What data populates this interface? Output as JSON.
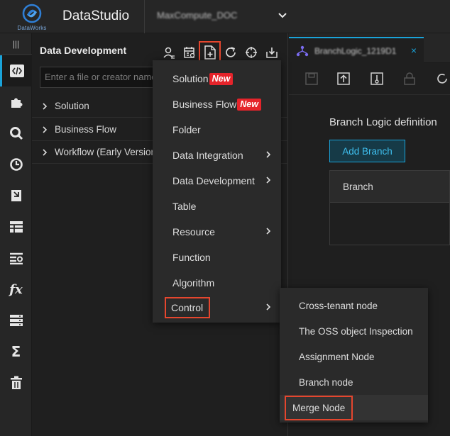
{
  "app": {
    "logo_text": "DataWorks",
    "title": "DataStudio",
    "project": "MaxCompute_DOC"
  },
  "rail": {
    "items": [
      {
        "icon": "code-icon",
        "active": true
      },
      {
        "icon": "puzzle-icon"
      },
      {
        "icon": "search-icon"
      },
      {
        "icon": "clock-icon"
      },
      {
        "icon": "bookmark-icon"
      },
      {
        "icon": "table-icon"
      },
      {
        "icon": "list-settings-icon"
      },
      {
        "icon": "function-icon",
        "glyph": "fx"
      },
      {
        "icon": "stack-icon"
      },
      {
        "icon": "sigma-icon",
        "glyph": "Σ"
      },
      {
        "icon": "trash-icon"
      }
    ]
  },
  "panel": {
    "title": "Data Development",
    "search_placeholder": "Enter a file or creator name",
    "tree": [
      {
        "label": "Solution"
      },
      {
        "label": "Business Flow"
      },
      {
        "label": "Workflow (Early Version"
      }
    ]
  },
  "tab": {
    "name": "BranchLogic_1219D1",
    "close": "×"
  },
  "editor": {
    "branch_title": "Branch Logic definition",
    "add_branch_label": "Add Branch",
    "table_header": "Branch"
  },
  "menu": {
    "items": [
      {
        "label": "Solution",
        "badge": "New"
      },
      {
        "label": "Business Flow",
        "badge": "New"
      },
      {
        "label": "Folder"
      },
      {
        "label": "Data Integration",
        "submenu": true
      },
      {
        "label": "Data Development",
        "submenu": true
      },
      {
        "label": "Table"
      },
      {
        "label": "Resource",
        "submenu": true
      },
      {
        "label": "Function"
      },
      {
        "label": "Algorithm"
      },
      {
        "label": "Control",
        "submenu": true,
        "highlighted": true
      }
    ]
  },
  "submenu": {
    "items": [
      {
        "label": "Cross-tenant node"
      },
      {
        "label": "The OSS object Inspection"
      },
      {
        "label": "Assignment Node"
      },
      {
        "label": "Branch node"
      },
      {
        "label": "Merge Node",
        "highlighted": true
      }
    ]
  },
  "colors": {
    "accent": "#1aa3d9",
    "highlight_box": "#e5462e",
    "new_badge": "#e5242b"
  }
}
